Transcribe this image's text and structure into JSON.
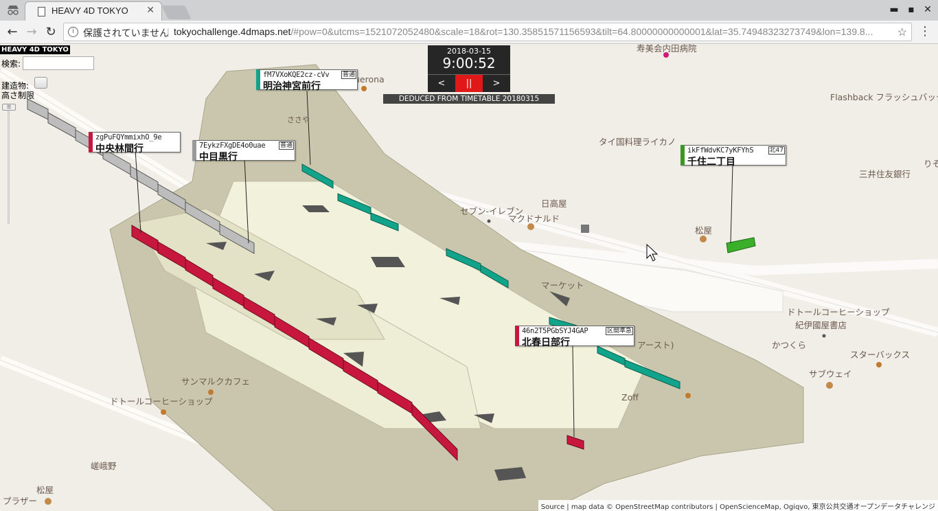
{
  "browser": {
    "tab_title": "HEAVY 4D TOKYO",
    "tab_close": "✕",
    "security_text": "保護されていません",
    "url_domain": "tokyochallenge.4dmaps.net",
    "url_rest": "/#pow=0&utcms=1521072052480&scale=18&rot=130.35851571156593&tilt=64.80000000000001&lat=35.74948323273749&lon=139.8...",
    "win_minimize": "▬",
    "win_maximize": "▪",
    "win_close": "✕"
  },
  "app": {
    "title": "HEAVY 4D TOKYO",
    "search_label": "検索:",
    "search_value": "",
    "building_label_1": "建造物:",
    "building_label_2": "高さ制限"
  },
  "clock": {
    "date": "2018-03-15",
    "time": "9:00:52",
    "prev": "<",
    "pause": "||",
    "next": ">",
    "deduced": "DEDUCED FROM TIMETABLE 20180315"
  },
  "trains": [
    {
      "id": "fM7VXoKQE2cz-cVv",
      "dest": "明治神宮前行",
      "kind": "普通",
      "color": "#12a48a"
    },
    {
      "id": "zgPuFQYmmixhO_9e",
      "dest": "中央林間行",
      "kind": "",
      "color": "#c8173d"
    },
    {
      "id": "7EykzFXgDE4o0uae",
      "dest": "中目黒行",
      "kind": "普通",
      "color": "#9a9a9a"
    },
    {
      "id": "ikFfWdvKC7yKFYhS",
      "dest": "千住二丁目",
      "kind": "北47",
      "color": "#3a9a1f"
    },
    {
      "id": "46n2T5PGbSYJ4GAP",
      "dest": "北春日部行",
      "kind": "区間準急",
      "color": "#c8173d"
    }
  ],
  "map_labels": {
    "uerona": "uerona",
    "flashback": "Flashback フラッシュバック",
    "tai": "タイ国料理ライカノ",
    "mitsui": "三井住友銀行",
    "seven": "セブン-イレブン",
    "hidakaya": "日高屋",
    "mcd": "マクドナルド",
    "matsuya1": "松屋",
    "market": "マーケット",
    "doutor1": "ドトールコーヒーショップ",
    "kinokuniya": "紀伊國屋書店",
    "katsukura": "かつくら",
    "starbucks": "スターバックス",
    "subway": "サブウェイ",
    "zoff": "Zoff",
    "easto": "アースト)",
    "sanmaru": "サンマルクカフェ",
    "doutor2": "ドトールコーヒーショップ",
    "sagano": "嵯峨野",
    "matsuya2": "松屋",
    "plaza": "プラザー",
    "kiyo": "寿美会内田病院",
    "sasaya": "ささや",
    "ri": "りそ"
  },
  "attribution": "Source | map data © OpenStreetMap contributors | OpenScienceMap, Ogiqvo, 東京公共交通オープンデータチャレンジ"
}
